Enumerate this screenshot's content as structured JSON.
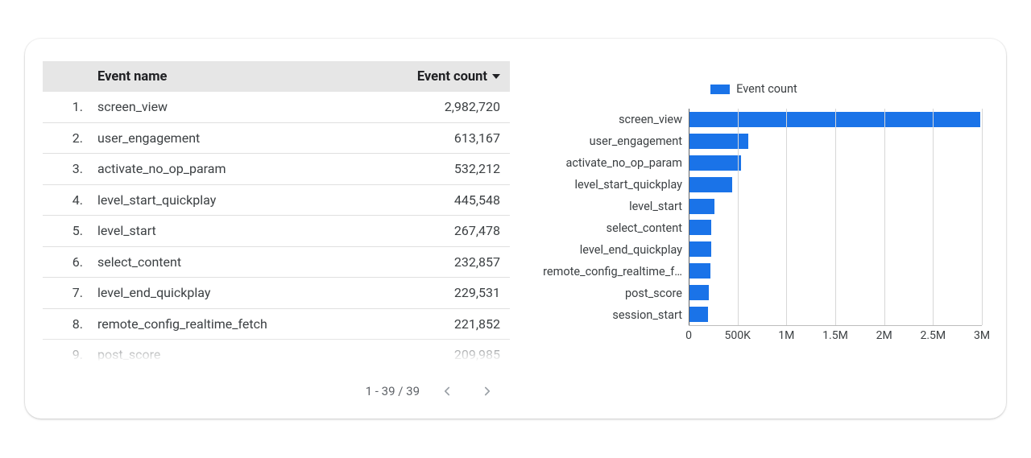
{
  "table": {
    "headers": {
      "name": "Event name",
      "count": "Event count"
    },
    "rows": [
      {
        "idx": "1.",
        "name": "screen_view",
        "count": "2,982,720"
      },
      {
        "idx": "2.",
        "name": "user_engagement",
        "count": "613,167"
      },
      {
        "idx": "3.",
        "name": "activate_no_op_param",
        "count": "532,212"
      },
      {
        "idx": "4.",
        "name": "level_start_quickplay",
        "count": "445,548"
      },
      {
        "idx": "5.",
        "name": "level_start",
        "count": "267,478"
      },
      {
        "idx": "6.",
        "name": "select_content",
        "count": "232,857"
      },
      {
        "idx": "7.",
        "name": "level_end_quickplay",
        "count": "229,531"
      },
      {
        "idx": "8.",
        "name": "remote_config_realtime_fetch",
        "count": "221,852"
      },
      {
        "idx": "9.",
        "name": "post_score",
        "count": "209,985"
      }
    ],
    "pager": {
      "text": "1 - 39 / 39"
    }
  },
  "legend": {
    "label": "Event count"
  },
  "chart_data": {
    "type": "bar",
    "orientation": "horizontal",
    "title": "",
    "xlabel": "",
    "ylabel": "",
    "xlim": [
      0,
      3000000
    ],
    "xticks": [
      0,
      500000,
      1000000,
      1500000,
      2000000,
      2500000,
      3000000
    ],
    "xtick_labels": [
      "0",
      "500K",
      "1M",
      "1.5M",
      "2M",
      "2.5M",
      "3M"
    ],
    "categories": [
      "screen_view",
      "user_engagement",
      "activate_no_op_param",
      "level_start_quickplay",
      "level_start",
      "select_content",
      "level_end_quickplay",
      "remote_config_realtime_f…",
      "post_score",
      "session_start"
    ],
    "values": [
      2982720,
      613167,
      532212,
      445548,
      267478,
      232857,
      229531,
      221852,
      209985,
      200000
    ],
    "color": "#1a73e8",
    "legend": "Event count"
  }
}
